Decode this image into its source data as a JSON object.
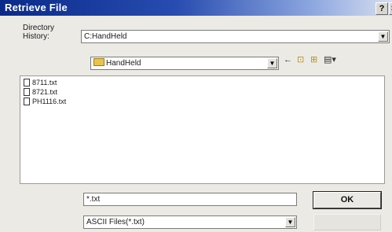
{
  "window": {
    "title": "Retrieve File",
    "help_label": "?",
    "close_label": "×"
  },
  "directory_history": {
    "label_line1": "Directory",
    "label_line2": "History:",
    "value": "C:HandHeld"
  },
  "look_in": {
    "value": "HandHeld"
  },
  "toolbar": {
    "back_glyph": "←",
    "up_glyph": "⊡",
    "new_folder_glyph": "⊞",
    "view_glyph": "▤▾"
  },
  "files": [
    {
      "name": "8711.txt"
    },
    {
      "name": "8721.txt"
    },
    {
      "name": "PH1116.txt"
    }
  ],
  "file_name": {
    "value": "*.txt"
  },
  "file_type": {
    "value": "ASCII Files(*.txt)"
  },
  "buttons": {
    "ok_label": "OK"
  },
  "icons": {
    "dropdown": "chevron-down-icon",
    "folder": "folder-icon",
    "file": "document-icon"
  }
}
